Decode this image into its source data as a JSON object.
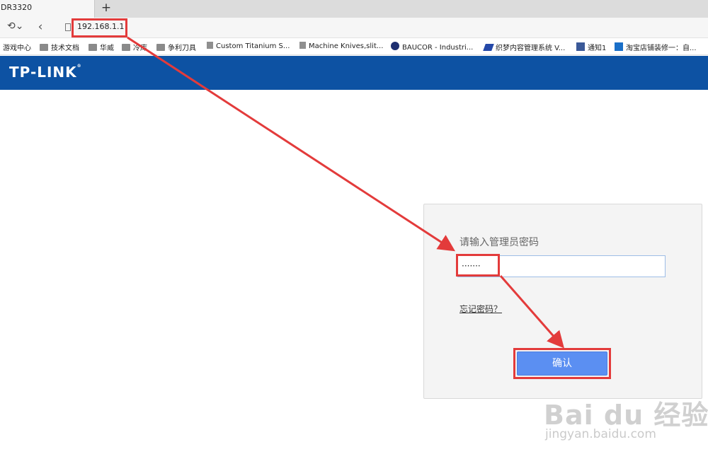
{
  "browser": {
    "tab_title": "DR3320",
    "new_tab_glyph": "+",
    "undo_glyph": "⟲⌄",
    "back_glyph": "‹",
    "address": "192.168.1.1",
    "page_icon": "page-icon"
  },
  "bookmarks": [
    {
      "label": "游戏中心",
      "icon": "none"
    },
    {
      "label": "技术文档",
      "icon": "folder-icon"
    },
    {
      "label": "华威",
      "icon": "folder-icon"
    },
    {
      "label": "冷库",
      "icon": "folder-icon"
    },
    {
      "label": "争利刀具",
      "icon": "folder-icon"
    },
    {
      "label": "Custom Titanium S...",
      "icon": "page-icon"
    },
    {
      "label": "Machine Knives,slit...",
      "icon": "page-icon"
    },
    {
      "label": "BAUCOR - Industri...",
      "icon": "baucor-icon"
    },
    {
      "label": "织梦内容管理系统 V...",
      "icon": "dedecms-icon"
    },
    {
      "label": "通知1",
      "icon": "facebook-icon"
    },
    {
      "label": "淘宝店铺装修一：自...",
      "icon": "paw-icon"
    }
  ],
  "header": {
    "logo_text": "TP-LINK",
    "brand_color": "#0d52a3"
  },
  "login": {
    "prompt": "请输入管理员密码",
    "password_value": "·······",
    "forgot_link": "忘记密码？",
    "confirm_label": "确认",
    "button_color": "#5b8ff2"
  },
  "annotations": {
    "color": "#e33b3b"
  },
  "watermark": {
    "logo_text": "Bai du 经验",
    "url": "jingyan.baidu.com"
  }
}
